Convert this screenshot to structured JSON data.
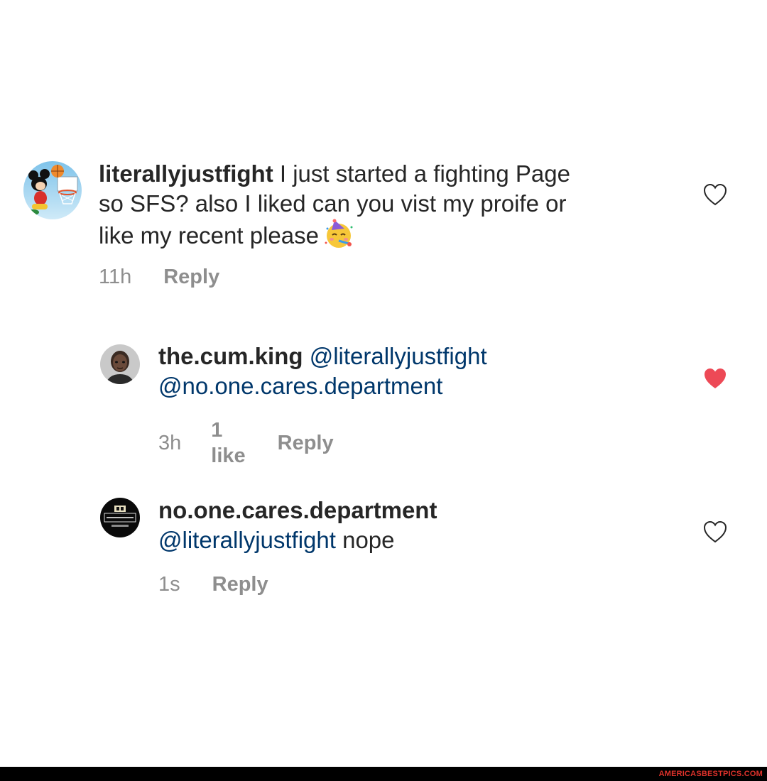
{
  "comments": [
    {
      "username": "literallyjustfight",
      "line1_text": " I just started a fighting Page",
      "line2_text": "so SFS?  also I liked can you vist my proife or",
      "line3_text": "like my recent please",
      "emoji": "partying-face",
      "time": "11h",
      "reply_label": "Reply",
      "liked": false
    },
    {
      "username": "the.cum.king",
      "mention1": "@literallyjustfight",
      "mention2": "@no.one.cares.department",
      "time": "3h",
      "likes_label": "1 like",
      "reply_label": "Reply",
      "liked": true
    },
    {
      "username": "no.one.cares.department",
      "mention1": "@literallyjustfight",
      "body_text": " nope",
      "time": "1s",
      "reply_label": "Reply",
      "liked": false
    }
  ],
  "footer": {
    "watermark": "AMERICASBESTPICS.COM"
  },
  "colors": {
    "text": "#262626",
    "mention": "#00376b",
    "meta": "#8e8e8e",
    "heart_liked": "#ed4956",
    "footer_bg": "#000000",
    "watermark": "#e0322b"
  },
  "icons": {
    "like": "heart-outline-icon",
    "liked": "heart-filled-icon"
  }
}
